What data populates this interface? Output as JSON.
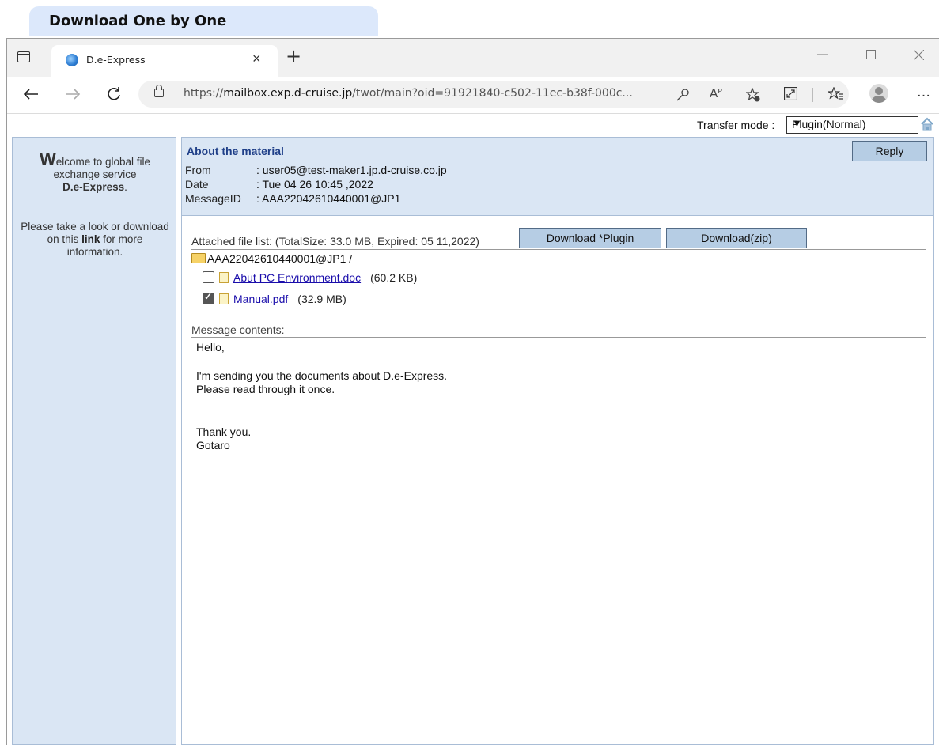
{
  "caption": "Download One by One",
  "browser": {
    "tab_title": "D.e-Express",
    "tab_close": "×",
    "new_tab": "+",
    "url_prefix": "https://",
    "url_domain": "mailbox.exp.d-cruise.jp",
    "url_path": "/twot/main?oid=91921840-c502-11ec-b38f-000c...",
    "read_aloud": "Aᴾ",
    "more": "…"
  },
  "page": {
    "transfer_label": "Transfer mode :",
    "transfer_value": "Plugin(Normal)",
    "sidebar": {
      "welcome_initial": "W",
      "welcome_rest": "elcome to global file exchange service",
      "product": "D.e-Express",
      "product_tail": ".",
      "info_pre": "Please take a look or download on this",
      "info_link": "link",
      "info_post": "for more information."
    },
    "message": {
      "subject": "About the material",
      "reply_label": "Reply",
      "from_label": "From",
      "from_value": ": user05@test-maker1.jp.d-cruise.co.jp",
      "date_label": "Date",
      "date_value": ": Tue 04 26 10:45 ,2022",
      "msgid_label": "MessageID",
      "msgid_value": ": AAA22042610440001@JP1",
      "attach_label": "Attached file list: (TotalSize: 33.0 MB, Expired: 05 11,2022)",
      "download_plugin_label": "Download *Plugin",
      "download_zip_label": "Download(zip)",
      "folder": "AAA22042610440001@JP1 /",
      "files": [
        {
          "name": "Abut PC Environment.doc",
          "size": "(60.2 KB)",
          "checked": false
        },
        {
          "name": "Manual.pdf",
          "size": "(32.9 MB)",
          "checked": true
        }
      ],
      "contents_label": "Message contents:",
      "body_lines": [
        "Hello,",
        "",
        "I'm sending you the documents about D.e-Express.",
        "Please read through it once.",
        "",
        "",
        "Thank you.",
        "Gotaro"
      ]
    }
  }
}
